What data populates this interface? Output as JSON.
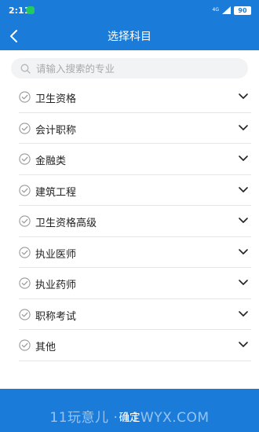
{
  "status_bar": {
    "time": "2:11",
    "network": "4G",
    "battery": "90"
  },
  "nav": {
    "title": "选择科目"
  },
  "search": {
    "placeholder": "请输入搜索的专业",
    "value": ""
  },
  "subjects": [
    {
      "label": "卫生资格"
    },
    {
      "label": "会计职称"
    },
    {
      "label": "金融类"
    },
    {
      "label": "建筑工程"
    },
    {
      "label": "卫生资格高级"
    },
    {
      "label": "执业医师"
    },
    {
      "label": "执业药师"
    },
    {
      "label": "职称考试"
    },
    {
      "label": "其他"
    }
  ],
  "confirm_label": "确定",
  "watermark": "11玩意儿 · 11WYX.COM",
  "colors": {
    "primary": "#1a7bd9",
    "notification": "#23c95e",
    "divider": "#e5e5e5"
  },
  "icons": {
    "back": "chevron-left-icon",
    "search": "search-icon",
    "check": "check-circle-icon",
    "expand": "chevron-down-icon"
  }
}
